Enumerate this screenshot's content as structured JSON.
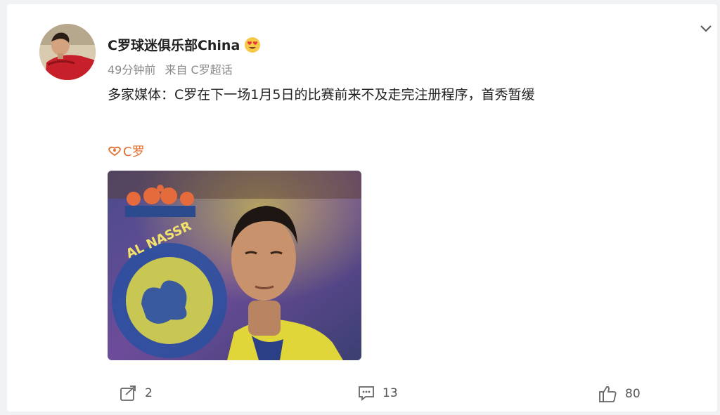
{
  "post": {
    "username": "C罗球迷俱乐部China",
    "time": "49分钟前",
    "source": "来自 C罗超话",
    "text": "多家媒体：C罗在下一场1月5日的比赛前来不及走完注册程序，首秀暂缓",
    "topic": "C罗"
  },
  "actions": {
    "share_count": "2",
    "comment_count": "13",
    "like_count": "80"
  },
  "icons": {
    "collapse": "chevron-down-icon",
    "emoji": "heart-eyes-emoji-icon",
    "topic": "supertopic-icon",
    "share": "share-icon",
    "comment": "comment-icon",
    "like": "thumbs-up-icon"
  },
  "colors": {
    "topic": "#e3702f",
    "text": "#222222",
    "meta": "#8a8a8a"
  }
}
